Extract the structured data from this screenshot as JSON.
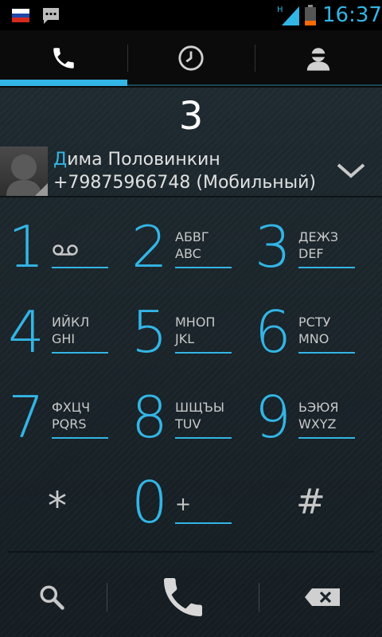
{
  "status_bar": {
    "time": "16:37",
    "network_type": "H",
    "icons": [
      "russia-flag-icon",
      "sms-icon",
      "signal-icon",
      "battery-icon"
    ],
    "colors": {
      "flag_white": "#ffffff",
      "flag_blue": "#2148a8",
      "flag_red": "#d52b1e",
      "battery_low": "#ff6a00"
    }
  },
  "tabs": [
    {
      "name": "phone",
      "icon": "phone-icon",
      "active": true
    },
    {
      "name": "recent",
      "icon": "clock-icon",
      "active": false
    },
    {
      "name": "contacts",
      "icon": "person-icon",
      "active": false
    }
  ],
  "dialer": {
    "entered_digits": "3",
    "suggestion": {
      "name_highlight": "Д",
      "name_rest": "има Половинкин",
      "phone": "+79875966748 (Мобильный)"
    },
    "keys": [
      {
        "num": "1",
        "l1": "",
        "l2": ""
      },
      {
        "num": "2",
        "l1": "АБВГ",
        "l2": "ABC"
      },
      {
        "num": "3",
        "l1": "ДЕЖЗ",
        "l2": "DEF"
      },
      {
        "num": "4",
        "l1": "ИЙКЛ",
        "l2": "GHI"
      },
      {
        "num": "5",
        "l1": "МНОП",
        "l2": "JKL"
      },
      {
        "num": "6",
        "l1": "РСТУ",
        "l2": "MNO"
      },
      {
        "num": "7",
        "l1": "ФХЦЧ",
        "l2": "PQRS"
      },
      {
        "num": "8",
        "l1": "ШЩЪЫ",
        "l2": "TUV"
      },
      {
        "num": "9",
        "l1": "ЬЭЮЯ",
        "l2": "WXYZ"
      },
      {
        "num": "0",
        "l1": "",
        "l2": "+"
      }
    ],
    "star": "*",
    "hash": "#"
  },
  "bottom_bar": {
    "icons": [
      "search-icon",
      "call-icon",
      "backspace-icon"
    ]
  },
  "colors": {
    "accent": "#33b5e5",
    "background": "#1a242a",
    "text": "#e0e0e0"
  }
}
